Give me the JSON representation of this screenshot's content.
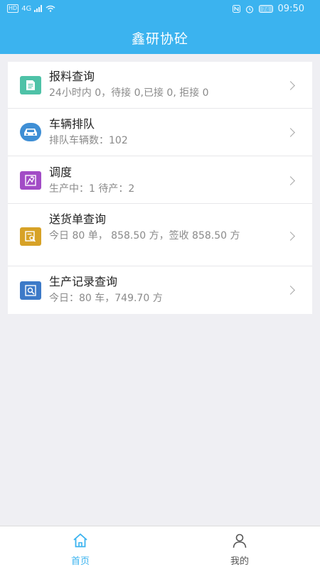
{
  "status_bar": {
    "network_badge": "HD",
    "signal_text": "4G",
    "battery": "74",
    "time": "09:50"
  },
  "header": {
    "title": "鑫研协砼"
  },
  "menu": {
    "items": [
      {
        "title": "报料查询",
        "subtitle": "24小时内 0，待接 0,已接 0, 拒接 0",
        "icon": "document-icon",
        "icon_color": "#4ec2a7"
      },
      {
        "title": "车辆排队",
        "subtitle": "排队车辆数：102",
        "icon": "car-icon",
        "icon_color": "#3f8fd5"
      },
      {
        "title": "调度",
        "subtitle": "生产中：1 待产：2",
        "icon": "dispatch-icon",
        "icon_color": "#a24cc6"
      },
      {
        "title": "送货单查询",
        "subtitle": "今日 80 单， 858.50 方，签收 858.50 方",
        "icon": "delivery-search-icon",
        "icon_color": "#d7a227"
      },
      {
        "title": "生产记录查询",
        "subtitle": "今日：80 车，749.70 方",
        "icon": "production-search-icon",
        "icon_color": "#3d7ac8"
      }
    ]
  },
  "tabbar": {
    "home_label": "首页",
    "mine_label": "我的",
    "active_color": "#3bb3ef",
    "inactive_color": "#555555"
  }
}
